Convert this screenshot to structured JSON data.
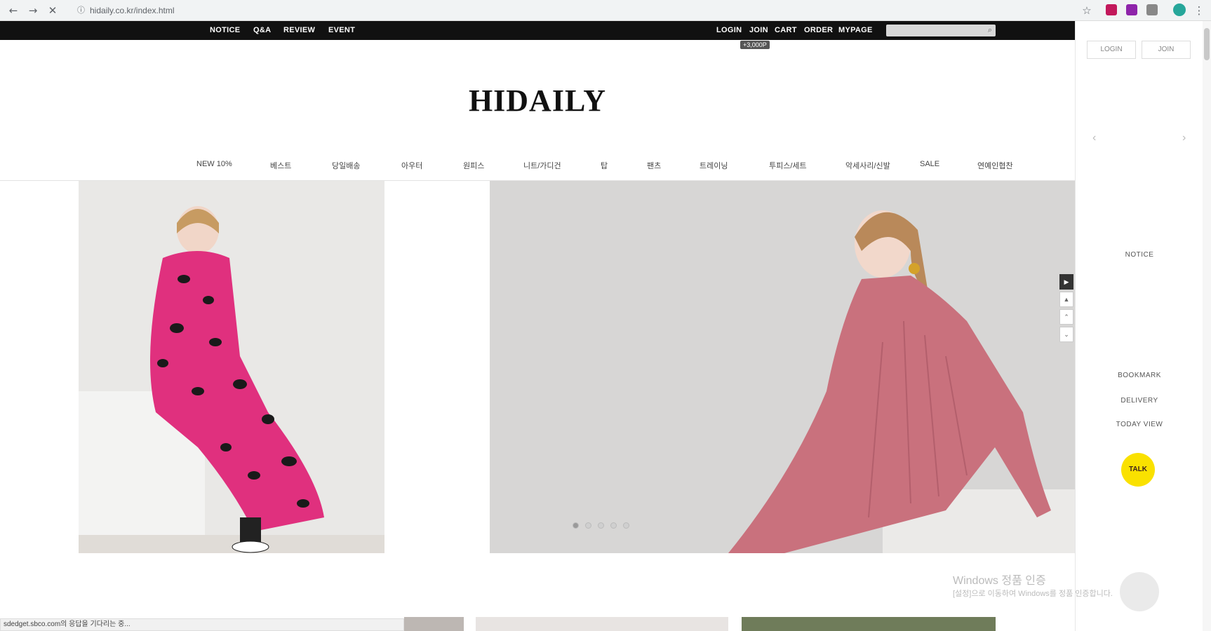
{
  "browser": {
    "url": "hidaily.co.kr/index.html"
  },
  "topbar": {
    "left_links": [
      "NOTICE",
      "Q&A",
      "REVIEW",
      "EVENT"
    ],
    "right_links": [
      "LOGIN",
      "JOIN",
      "CART",
      "ORDER",
      "MYPAGE"
    ],
    "tooltip": "+3,000P"
  },
  "brand": {
    "logo": "HIDAILY"
  },
  "categories": [
    "NEW 10%",
    "베스트",
    "당일배송",
    "아우터",
    "원피스",
    "니트/가디건",
    "탑",
    "팬츠",
    "트레이닝",
    "투피스/세트",
    "악세사리/신발",
    "SALE",
    "연예인협찬"
  ],
  "slider": {
    "dot_count": 5,
    "active_index": 0
  },
  "sidebar": {
    "login_label": "LOGIN",
    "join_label": "JOIN",
    "notice_label": "NOTICE",
    "bookmark_label": "BOOKMARK",
    "delivery_label": "DELIVERY",
    "today_view_label": "TODAY VIEW",
    "talk_label": "TALK"
  },
  "os": {
    "watermark_title": "Windows 정품 인증",
    "watermark_sub": "[설정]으로 이동하여 Windows를 정품 인증합니다."
  },
  "status_bar": {
    "text": "sdedget.sbco.com의 응답을 기다리는 중..."
  },
  "colors": {
    "topbar_bg": "#111111",
    "talk_yellow": "#fae100",
    "hero1_dress": "#e0307e",
    "hero2_dress": "#c9717d"
  }
}
